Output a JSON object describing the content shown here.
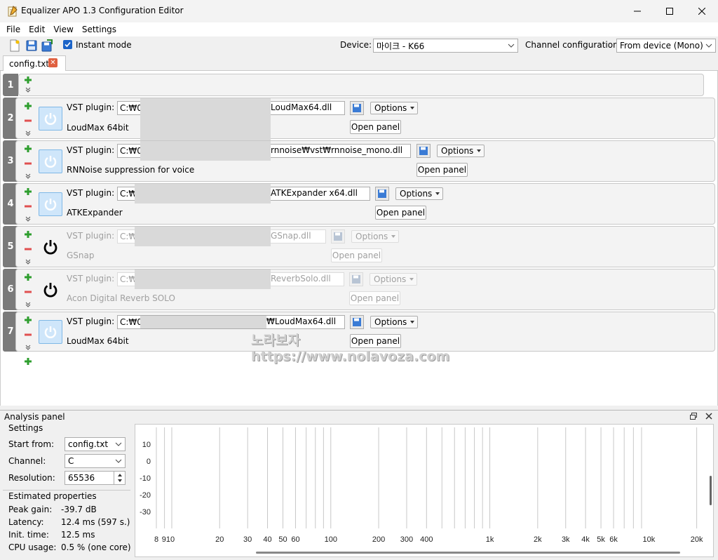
{
  "window": {
    "title": "Equalizer APO 1.3 Configuration Editor"
  },
  "menu": [
    "File",
    "Edit",
    "View",
    "Settings"
  ],
  "toolbar": {
    "instant_mode": "Instant mode",
    "device_label": "Device:",
    "device_value": "마이크 - K66",
    "channel_config_label": "Channel configuration:",
    "channel_config_value": "From device (Mono)"
  },
  "tab": {
    "label": "config.txt"
  },
  "rows": [
    {
      "num": "1"
    },
    {
      "num": "2",
      "vst_label": "VST plugin:",
      "path_start": "C:₩0",
      "path_end": "LoudMax64.dll",
      "name": "LoudMax 64bit",
      "options": "Options",
      "open": "Open panel"
    },
    {
      "num": "3",
      "vst_label": "VST plugin:",
      "path_start": "C:₩0",
      "path_end": "rnnoise₩vst₩rnnoise_mono.dll",
      "name": "RNNoise suppression for voice",
      "options": "Options",
      "open": "Open panel"
    },
    {
      "num": "4",
      "vst_label": "VST plugin:",
      "path_start": "C:₩",
      "path_end": "ATKExpander x64.dll",
      "name": "ATKExpander",
      "options": "Options",
      "open": "Open panel"
    },
    {
      "num": "5",
      "vst_label": "VST plugin:",
      "path_start": "C:₩",
      "path_end": "GSnap.dll",
      "name": "GSnap",
      "options": "Options",
      "open": "Open panel"
    },
    {
      "num": "6",
      "vst_label": "VST plugin:",
      "path_start": "C:₩",
      "path_end": "ReverbSolo.dll",
      "name": "Acon Digital Reverb SOLO",
      "options": "Options",
      "open": "Open panel"
    },
    {
      "num": "7",
      "vst_label": "VST plugin:",
      "path_start": "C:₩0",
      "path_end": "₩LoudMax64.dll",
      "name": "LoudMax 64bit",
      "options": "Options",
      "open": "Open panel"
    }
  ],
  "watermark": {
    "line1": "노라보자",
    "line2": "https://www.nolavoza.com"
  },
  "analysis": {
    "title": "Analysis panel",
    "settings_title": "Settings",
    "start_from_label": "Start from:",
    "start_from_value": "config.txt",
    "channel_label": "Channel:",
    "channel_value": "C",
    "resolution_label": "Resolution:",
    "resolution_value": "65536",
    "estimated_title": "Estimated properties",
    "peak_gain_label": "Peak gain:",
    "peak_gain_value": "-39.7 dB",
    "latency_label": "Latency:",
    "latency_value": "12.4 ms (597 s.)",
    "init_time_label": "Init. time:",
    "init_time_value": "12.5 ms",
    "cpu_label": "CPU usage:",
    "cpu_value": "0.5 % (one core)"
  },
  "chart_data": {
    "type": "line",
    "x_scale": "log",
    "x_ticks": [
      "8",
      "910",
      "20",
      "30",
      "40",
      "50",
      "60",
      "100",
      "200",
      "300",
      "400",
      "1k",
      "2k",
      "3k",
      "4k",
      "5k",
      "6k",
      "10k",
      "20k"
    ],
    "y_ticks": [
      "10",
      "0",
      "-10",
      "-20",
      "-30"
    ],
    "grid": true,
    "series": []
  }
}
